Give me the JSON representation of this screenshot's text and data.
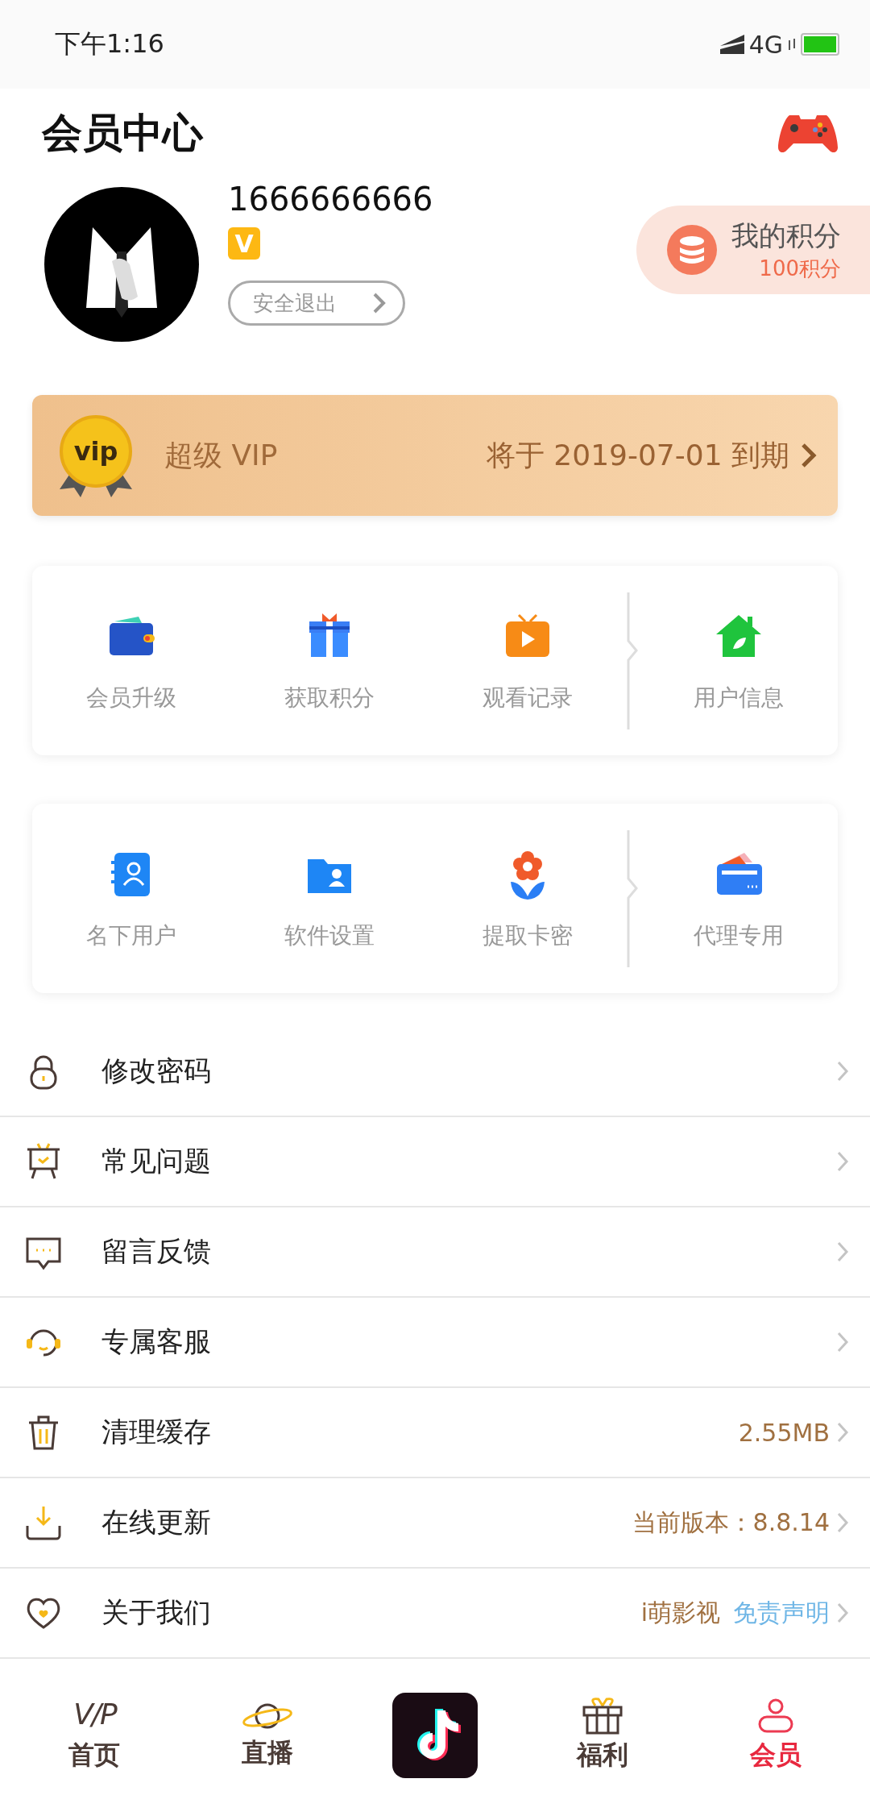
{
  "status_bar": {
    "time": "下午1:16",
    "network": "4G"
  },
  "header": {
    "title": "会员中心"
  },
  "profile": {
    "phone": "1666666666",
    "badge": "V",
    "logout": "安全退出",
    "points": {
      "title": "我的积分",
      "value": "100积分"
    }
  },
  "vip_card": {
    "medal": "vip",
    "title": "超级 VIP",
    "expiry": "将于 2019-07-01 到期"
  },
  "grids": [
    {
      "items": [
        {
          "label": "会员升级"
        },
        {
          "label": "获取积分"
        },
        {
          "label": "观看记录"
        },
        {
          "label": "用户信息"
        }
      ]
    },
    {
      "items": [
        {
          "label": "名下用户"
        },
        {
          "label": "软件设置"
        },
        {
          "label": "提取卡密"
        },
        {
          "label": "代理专用"
        }
      ]
    }
  ],
  "menu": [
    {
      "label": "修改密码"
    },
    {
      "label": "常见问题"
    },
    {
      "label": "留言反馈"
    },
    {
      "label": "专属客服"
    },
    {
      "label": "清理缓存",
      "value": "2.55MB"
    },
    {
      "label": "在线更新",
      "value": "当前版本：8.8.14"
    },
    {
      "label": "关于我们",
      "value": "i萌影视",
      "link": "免责声明"
    }
  ],
  "tabs": [
    {
      "kind": "text-icon",
      "icon_text": "V/P",
      "label": "首页",
      "selected": false
    },
    {
      "kind": "icon",
      "label": "直播",
      "selected": false
    },
    {
      "kind": "app",
      "selected": false
    },
    {
      "kind": "icon",
      "label": "福利",
      "selected": false
    },
    {
      "kind": "icon",
      "label": "会员",
      "selected": true
    }
  ]
}
